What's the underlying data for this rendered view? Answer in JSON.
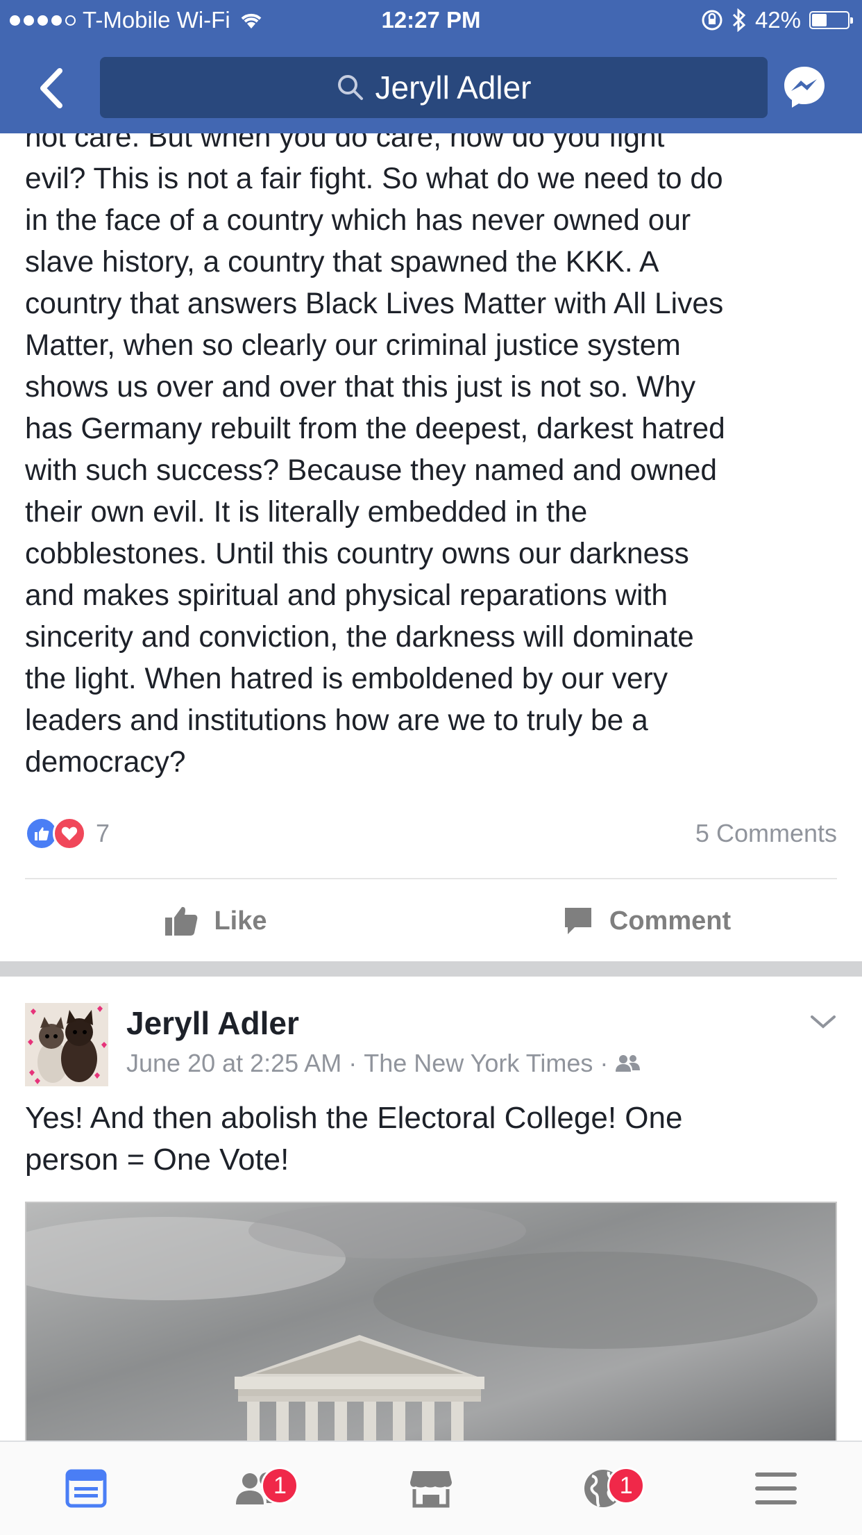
{
  "status_bar": {
    "carrier": "T-Mobile Wi-Fi",
    "time": "12:27 PM",
    "battery_percent": "42%",
    "battery_level": 0.42
  },
  "nav": {
    "search_text": "Jeryll Adler",
    "back_icon": "chevron-left-icon",
    "messenger_icon": "messenger-icon"
  },
  "post1": {
    "text_lines": [
      "not care. But when you do care, how do you fight",
      "evil? This is not a fair fight. So what do we need to do",
      "in the face of a country which has never owned our",
      "slave history, a country that spawned the KKK. A",
      "country that answers Black Lives Matter with All Lives",
      "Matter, when so clearly our criminal justice system",
      "shows us over and over that this just is not so. Why",
      "has Germany rebuilt from the deepest, darkest hatred",
      "with such success? Because they named and owned",
      "their own evil. It is literally embedded in the",
      "cobblestones. Until this country owns our darkness",
      "and makes spiritual and physical reparations with",
      "sincerity and conviction, the darkness will dominate",
      "the light. When hatred is emboldened by our very",
      "leaders and institutions how are we to truly be a",
      "democracy?"
    ],
    "reaction_count": "7",
    "comments_label": "5 Comments",
    "like_label": "Like",
    "comment_label": "Comment"
  },
  "post2": {
    "author": "Jeryll Adler",
    "date": "June 20 at 2:25 AM",
    "separator": "·",
    "source": "The New York Times",
    "text_line1": "Yes! And then abolish the Electoral College! One",
    "text_line2": "person = One Vote!"
  },
  "tabbar": {
    "tabs": [
      {
        "icon": "news-feed-icon",
        "badge": ""
      },
      {
        "icon": "friend-requests-icon",
        "badge": "1"
      },
      {
        "icon": "marketplace-icon",
        "badge": ""
      },
      {
        "icon": "notifications-globe-icon",
        "badge": "1"
      },
      {
        "icon": "menu-icon",
        "badge": ""
      }
    ]
  },
  "colors": {
    "brand_blue": "#4267b2",
    "search_bg": "#29487d",
    "badge_red": "#f02849",
    "like_blue": "#4a7ef5",
    "love_red": "#f0475a",
    "active_tab": "#4a7ef5",
    "inactive_tab": "#7f7f7f"
  }
}
